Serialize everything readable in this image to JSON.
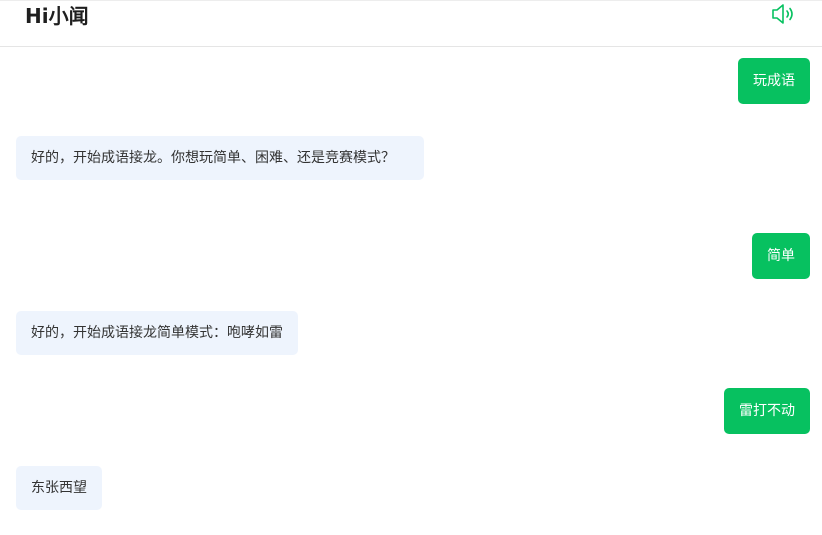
{
  "header": {
    "title": "Hi小闻",
    "speaker_icon": "speaker-volume-icon",
    "accent_color": "#07c160"
  },
  "messages": [
    {
      "role": "user",
      "text": "玩成语"
    },
    {
      "role": "bot",
      "text": "好的，开始成语接龙。你想玩简单、困难、还是竞赛模式？"
    },
    {
      "role": "user",
      "text": "简单"
    },
    {
      "role": "bot",
      "text": "好的，开始成语接龙简单模式：咆哮如雷"
    },
    {
      "role": "user",
      "text": "雷打不动"
    },
    {
      "role": "bot",
      "text": "东张西望"
    }
  ],
  "colors": {
    "user_bubble": "#07c160",
    "bot_bubble": "#eef4fd"
  }
}
